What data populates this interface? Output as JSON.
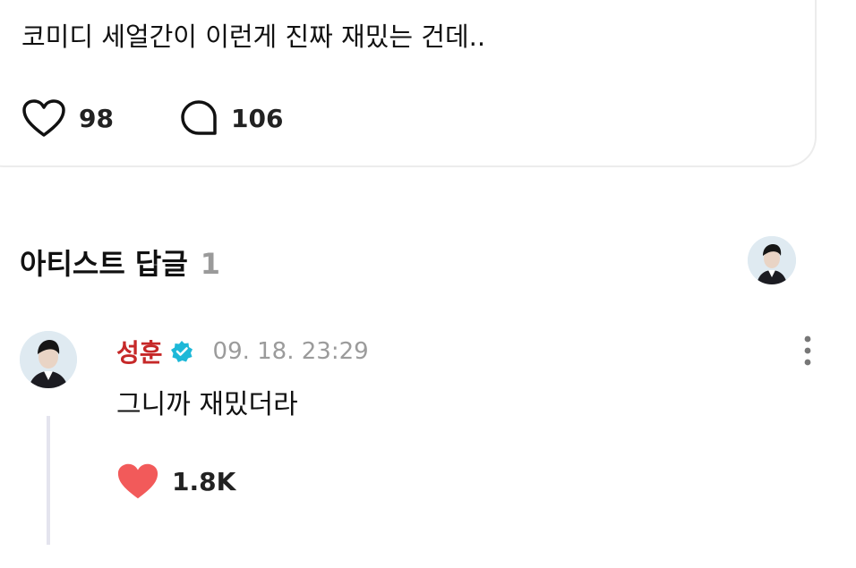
{
  "post": {
    "text": "코미디 세얼간이 이런게 진짜 재밌는 건데..",
    "likes": "98",
    "comments": "106"
  },
  "section": {
    "title": "아티스트 답글",
    "count": "1"
  },
  "reply": {
    "author": "성훈",
    "timestamp": "09. 18. 23:29",
    "text": "그니까 재밌더라",
    "likes": "1.8K"
  },
  "colors": {
    "author": "#c62828",
    "verified": "#1db8d8",
    "heart_filled": "#f25a5a",
    "muted": "#9b9b9b"
  },
  "icons": [
    "heart-outline-icon",
    "comment-bubble-icon",
    "verified-badge-icon",
    "more-vertical-icon",
    "heart-filled-icon"
  ]
}
